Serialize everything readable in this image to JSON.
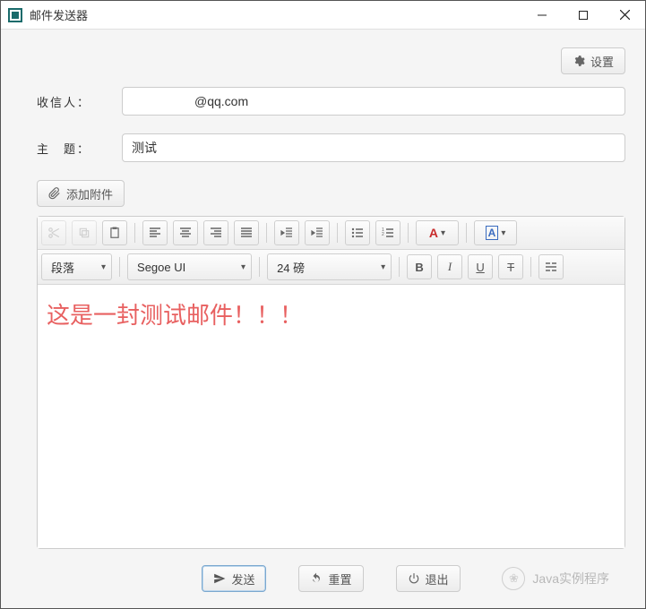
{
  "window": {
    "title": "邮件发送器"
  },
  "actions": {
    "settings": "设置",
    "attach": "添加附件",
    "send": "发送",
    "reset": "重置",
    "exit": "退出"
  },
  "fields": {
    "recipient_label": "收信人：",
    "recipient_value": "　　　　　@qq.com",
    "subject_label": "主　题：",
    "subject_value": "测试"
  },
  "editor": {
    "format_paragraph": "段落",
    "font_family": "Segoe UI",
    "font_size": "24 磅",
    "content": "这是一封测试邮件！！！"
  },
  "watermark": "Java实例程序"
}
